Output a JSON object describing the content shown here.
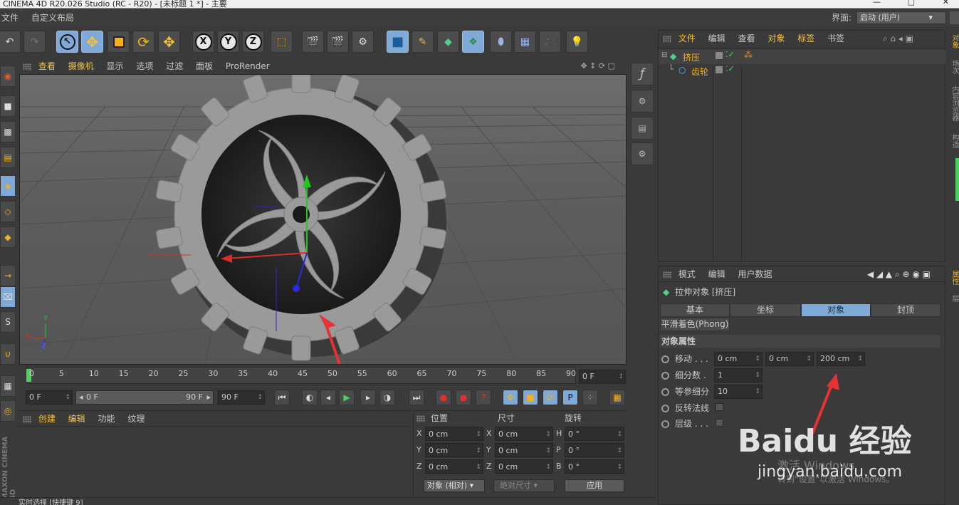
{
  "window": {
    "title": "CINEMA 4D R20.026 Studio (RC - R20) - [未标题 1 *] - 主要"
  },
  "menubar": {
    "items": [
      "文件",
      "自定义布局"
    ],
    "layout_label": "界面:",
    "layout_value": "启动 (用户)"
  },
  "toolbar": {
    "icons": [
      "undo-icon",
      "redo-icon",
      "live-select-icon",
      "move-icon",
      "scale-icon",
      "rotate-icon",
      "move-recent-icon",
      "x-axis-lock-icon",
      "y-axis-lock-icon",
      "z-axis-lock-icon",
      "coordinate-system-icon",
      "render-view-icon",
      "render-picture-viewer-icon",
      "render-settings-icon",
      "cube-icon",
      "pen-icon",
      "subdivision-icon",
      "array-icon",
      "deformer-icon",
      "floor-icon",
      "camera-icon",
      "light-icon"
    ],
    "axis_labels": [
      "X",
      "Y",
      "Z"
    ]
  },
  "viewport": {
    "menu": [
      "查看",
      "摄像机",
      "显示",
      "选项",
      "过滤",
      "面板",
      "ProRender"
    ],
    "axis_y": "Y",
    "axis_x": "X",
    "axis_z": "Z"
  },
  "timeline": {
    "ticks": [
      "0",
      "5",
      "10",
      "15",
      "20",
      "25",
      "30",
      "35",
      "40",
      "45",
      "50",
      "55",
      "60",
      "65",
      "70",
      "75",
      "80",
      "85",
      "90"
    ],
    "current": "0 F"
  },
  "playback": {
    "start": "0 F",
    "range_start": "0 F",
    "range_end": "90 F",
    "end": "90 F"
  },
  "material": {
    "menu": [
      "创建",
      "编辑",
      "功能",
      "纹理"
    ]
  },
  "coords": {
    "headers": [
      "位置",
      "尺寸",
      "旋转"
    ],
    "rows": [
      {
        "axis": "X",
        "pos": "0 cm",
        "axis2": "X",
        "size": "0 cm",
        "rot_axis": "H",
        "rot": "0 °"
      },
      {
        "axis": "Y",
        "pos": "0 cm",
        "axis2": "Y",
        "size": "0 cm",
        "rot_axis": "P",
        "rot": "0 °"
      },
      {
        "axis": "Z",
        "pos": "0 cm",
        "axis2": "Z",
        "size": "0 cm",
        "rot_axis": "B",
        "rot": "0 °"
      }
    ],
    "mode": "对象 (相对)",
    "size_mode": "绝对尺寸",
    "apply": "应用"
  },
  "object_manager": {
    "menu": [
      "文件",
      "编辑",
      "查看",
      "对象",
      "标签",
      "书签"
    ],
    "objects": [
      {
        "name": "挤压"
      },
      {
        "name": "齿轮"
      }
    ]
  },
  "attributes": {
    "menu": [
      "模式",
      "编辑",
      "用户数据"
    ],
    "object_title": "拉伸对象 [挤压]",
    "tabs": [
      "基本",
      "坐标",
      "对象",
      "封顶"
    ],
    "phong_tab": "平滑着色(Phong)",
    "section": "对象属性",
    "props": {
      "move_label": "移动 . . .",
      "move_x": "0 cm",
      "move_y": "0 cm",
      "move_z": "200 cm",
      "subdiv_label": "细分数 .",
      "subdiv": "1",
      "iso_label": "等参细分",
      "iso": "10",
      "flip_label": "反转法线",
      "hier_label": "层级 . . ."
    }
  },
  "right_strip": {
    "tabs": [
      "对象",
      "场次",
      "内容浏览器",
      "构造",
      "属性",
      "层"
    ]
  },
  "left_strip": {
    "brand": "MAXON CINEMA 4D"
  },
  "status": {
    "text": "实时选择 [快捷键 9]"
  },
  "watermark": {
    "brand": "Baidu 经验",
    "site": "jingyan.baidu.com",
    "activate": "激活 Windows",
    "activate_hint": "转到\"设置\"以激活 Windows。"
  },
  "colors": {
    "accent": "#7fa9d6",
    "highlight": "#f5c242",
    "arrow": "#e63232"
  }
}
